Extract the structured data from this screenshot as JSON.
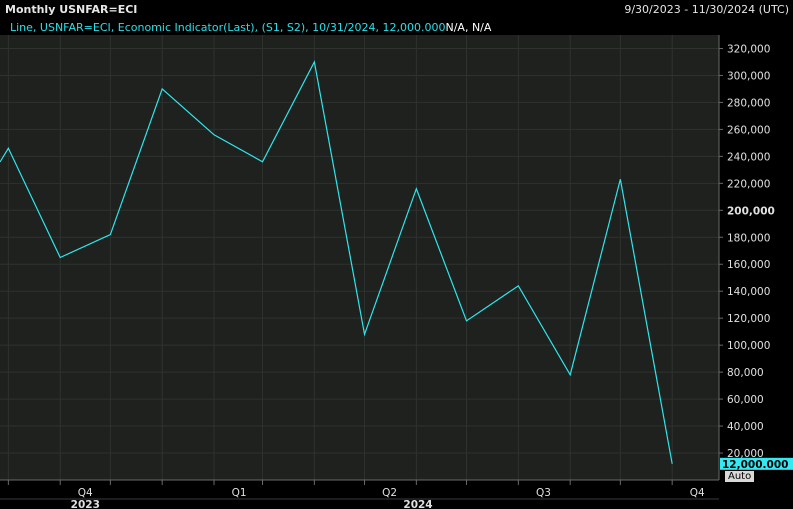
{
  "header": {
    "title": "Monthly USNFAR=ECI",
    "date_range": "9/30/2023 - 11/30/2024 (UTC)"
  },
  "legend": {
    "text": "Line, USNFAR=ECI, Economic Indicator(Last), (S1, S2), 10/31/2024, 12,000.000",
    "na_text": "N/A, N/A"
  },
  "controls": {
    "auto_label": "Auto"
  },
  "colors": {
    "background": "#000000",
    "plot_background": "#1e211e",
    "line": "#2ee6ec",
    "grid": "#2f332f",
    "current_value_badge": "#35e9f2"
  },
  "chart_data": {
    "type": "line",
    "title": "Monthly USNFAR=ECI",
    "x": [
      "2023-09-30",
      "2023-10-31",
      "2023-11-30",
      "2023-12-31",
      "2024-01-31",
      "2024-02-29",
      "2024-03-31",
      "2024-04-30",
      "2024-05-31",
      "2024-06-30",
      "2024-07-31",
      "2024-08-31",
      "2024-09-30",
      "2024-10-31"
    ],
    "series": [
      {
        "name": "USNFAR=ECI",
        "values": [
          246000,
          165000,
          182000,
          290000,
          256000,
          236000,
          310000,
          108000,
          216000,
          118000,
          144000,
          78000,
          223000,
          12000
        ]
      }
    ],
    "ylim": [
      0,
      330000
    ],
    "y_ticks": [
      20000,
      40000,
      60000,
      80000,
      100000,
      120000,
      140000,
      160000,
      180000,
      200000,
      220000,
      240000,
      260000,
      280000,
      300000,
      320000
    ],
    "y_tick_labels": [
      "20,000",
      "40,000",
      "60,000",
      "80,000",
      "100,000",
      "120,000",
      "140,000",
      "160,000",
      "180,000",
      "200,000",
      "220,000",
      "240,000",
      "260,000",
      "280,000",
      "300,000",
      "320,000"
    ],
    "highlight_tick": "200,000",
    "x_quarter_labels": [
      {
        "label": "Q4",
        "date": "2023-11-15"
      },
      {
        "label": "Q1",
        "date": "2024-02-15"
      },
      {
        "label": "Q2",
        "date": "2024-05-15"
      },
      {
        "label": "Q3",
        "date": "2024-08-15"
      },
      {
        "label": "Q4",
        "date": "2024-11-15"
      }
    ],
    "x_year_labels": [
      {
        "label": "2023",
        "date": "2023-11-15"
      },
      {
        "label": "2024",
        "date": "2024-06-01"
      }
    ],
    "last_value_label": "12,000.000",
    "grid": true,
    "axis_position": "right"
  }
}
